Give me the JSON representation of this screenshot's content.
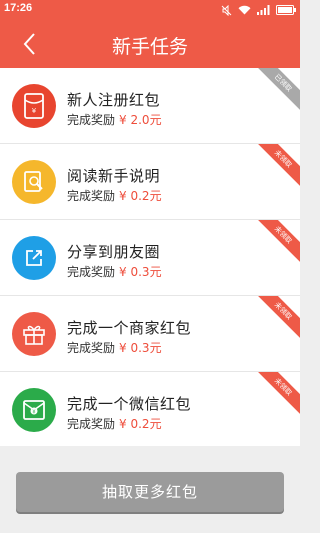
{
  "status": {
    "time": "17:26"
  },
  "nav": {
    "title": "新手任务"
  },
  "colors": {
    "accent": "#ee5a47",
    "reward": "#ee4d3b",
    "claimed_ribbon": "#a9a9a9",
    "unclaimed_ribbon": "#ee5a47"
  },
  "tasks": [
    {
      "name": "新人注册红包",
      "reward_label": "完成奖励",
      "amount": "¥ 2.0",
      "unit": "元",
      "status": "已领取",
      "icon": "red-envelope-icon",
      "icon_color": "#e8452f"
    },
    {
      "name": "阅读新手说明",
      "reward_label": "完成奖励",
      "amount": "¥ 0.2",
      "unit": "元",
      "status": "未领取",
      "icon": "document-search-icon",
      "icon_color": "#f5b72c"
    },
    {
      "name": "分享到朋友圈",
      "reward_label": "完成奖励",
      "amount": "¥ 0.3",
      "unit": "元",
      "status": "未领取",
      "icon": "share-icon",
      "icon_color": "#1f9fe6"
    },
    {
      "name": "完成一个商家红包",
      "reward_label": "完成奖励",
      "amount": "¥ 0.3",
      "unit": "元",
      "status": "未领取",
      "icon": "gift-icon",
      "icon_color": "#ee5a47"
    },
    {
      "name": "完成一个微信红包",
      "reward_label": "完成奖励",
      "amount": "¥ 0.2",
      "unit": "元",
      "status": "未领取",
      "icon": "wechat-envelope-icon",
      "icon_color": "#2bab4a"
    }
  ],
  "footer": {
    "button_label": "抽取更多红包"
  }
}
